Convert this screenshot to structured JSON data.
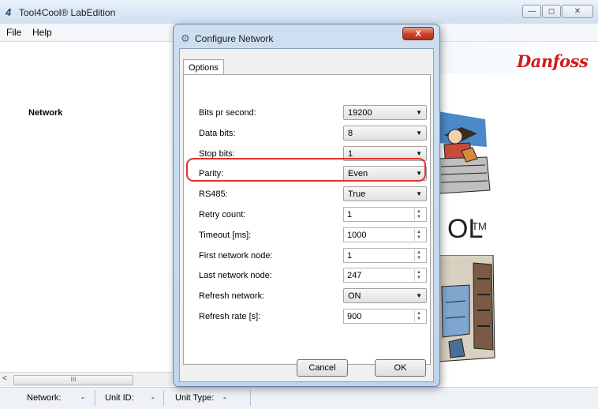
{
  "app": {
    "title": "Tool4Cool® LabEdition",
    "icon": "tool4cool-logo-icon"
  },
  "window_buttons": {
    "minimize": "—",
    "maximize": "◻",
    "close": "✕"
  },
  "menu": [
    "File",
    "Help"
  ],
  "sidebar": {
    "network_label": "Network"
  },
  "brand": {
    "logo_text": "Danfoss",
    "logo_color": "#d01c1c",
    "product_suffix": "OL",
    "trademark": "TM"
  },
  "scroll": {
    "left_arrow": "<",
    "thumb_grip": "III"
  },
  "status": {
    "network_label": "Network:",
    "network_value": "-",
    "unit_id_label": "Unit ID:",
    "unit_id_value": "-",
    "unit_type_label": "Unit Type:",
    "unit_type_value": "-"
  },
  "dialog": {
    "title": "Configure Network",
    "close": "X",
    "tab": "Options",
    "fields": [
      {
        "label": "Bits pr second:",
        "type": "select",
        "value": "19200"
      },
      {
        "label": "Data bits:",
        "type": "select",
        "value": "8"
      },
      {
        "label": "Stop bits:",
        "type": "select",
        "value": "1"
      },
      {
        "label": "Parity:",
        "type": "select",
        "value": "Even"
      },
      {
        "label": "RS485:",
        "type": "select",
        "value": "True"
      },
      {
        "label": "Retry count:",
        "type": "spin",
        "value": "1"
      },
      {
        "label": "Timeout [ms]:",
        "type": "spin",
        "value": "1000"
      },
      {
        "label": "First network node:",
        "type": "spin",
        "value": "1"
      },
      {
        "label": "Last network node:",
        "type": "spin",
        "value": "247"
      },
      {
        "label": "Refresh network:",
        "type": "select",
        "value": "ON"
      },
      {
        "label": "Refresh rate [s]:",
        "type": "spin",
        "value": "900"
      }
    ],
    "cancel_label": "Cancel",
    "ok_label": "OK",
    "highlight_color": "#e2312d"
  }
}
